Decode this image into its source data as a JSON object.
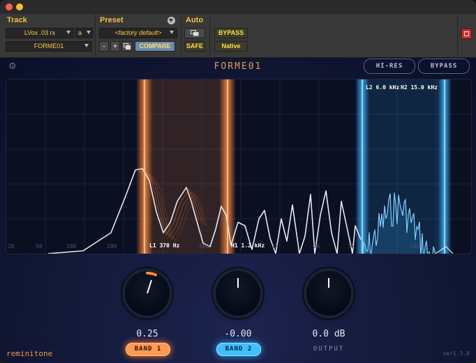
{
  "host": {
    "track_label": "Track",
    "track_name": "LVox .03 rx",
    "track_channel": "a",
    "plugin_name": "FORME01",
    "preset_label": "Preset",
    "preset_value": "<factory default>",
    "minus_label": "-",
    "plus_label": "+",
    "compare_label": "COMPARE",
    "auto_label": "Auto",
    "safe_label": "SAFE",
    "bypass_label": "BYPASS",
    "native_label": "Native"
  },
  "plugin": {
    "title": "FORME01",
    "hires_label": "HI-RES",
    "bypass_label": "BYPASS",
    "brand": "reminitone",
    "version": "ver1.3.0"
  },
  "display": {
    "freq_ticks": [
      "20",
      "50",
      "100",
      "200",
      "500",
      "1k",
      "2k",
      "5k",
      "10k"
    ],
    "markers": {
      "l1": "L1 370 Hz",
      "h1": "H1 1.2 kHz",
      "l2": "L2 6.0 kHz",
      "h2": "H2 15.0 kHz"
    },
    "band1_color": "#ff8a3a",
    "band2_color": "#3ab4ff"
  },
  "knobs": {
    "band1_value": "0.25",
    "band2_value": "-0.00",
    "output_value": "0.0 dB",
    "band1_label": "BAND 1",
    "band2_label": "BAND 2",
    "output_label": "OUTPUT"
  }
}
